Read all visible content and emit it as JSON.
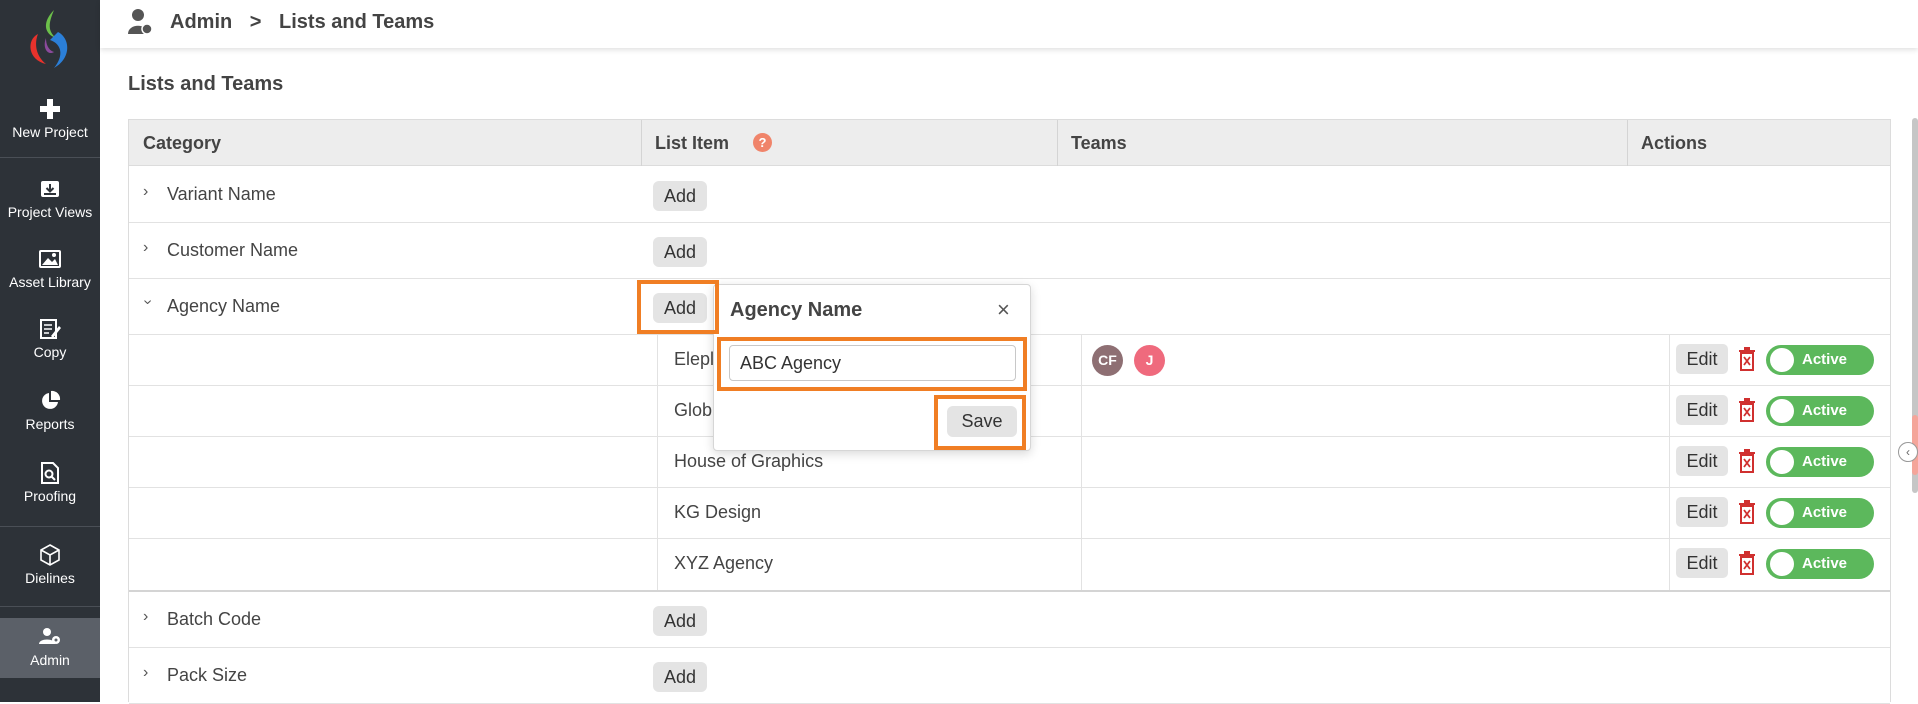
{
  "sidebar": {
    "items": [
      {
        "label": "New Project",
        "icon": "plus-icon"
      },
      {
        "label": "Project Views",
        "icon": "project-views-icon"
      },
      {
        "label": "Asset Library",
        "icon": "image-icon"
      },
      {
        "label": "Copy",
        "icon": "copy-edit-icon"
      },
      {
        "label": "Reports",
        "icon": "pie-chart-icon"
      },
      {
        "label": "Proofing",
        "icon": "proofing-search-icon"
      },
      {
        "label": "Dielines",
        "icon": "cube-icon"
      },
      {
        "label": "Admin",
        "icon": "admin-user-icon"
      }
    ]
  },
  "header": {
    "breadcrumb": {
      "root": "Admin",
      "separator": ">",
      "current": "Lists and Teams"
    }
  },
  "page": {
    "title": "Lists and Teams"
  },
  "table": {
    "columns": {
      "category": "Category",
      "list_item": "List Item",
      "help": "?",
      "teams": "Teams",
      "actions": "Actions"
    },
    "add_label": "Add",
    "edit_label": "Edit",
    "active_label": "Active",
    "categories": [
      {
        "label": "Variant Name",
        "expanded": false
      },
      {
        "label": "Customer Name",
        "expanded": false
      },
      {
        "label": "Agency Name",
        "expanded": true
      },
      {
        "label": "Batch Code",
        "expanded": false
      },
      {
        "label": "Pack Size",
        "expanded": false
      }
    ],
    "agency_items": [
      {
        "label": "Elephant",
        "teams": [
          "CF",
          "J"
        ]
      },
      {
        "label": "Global",
        "teams": []
      },
      {
        "label": "House of Graphics",
        "teams": []
      },
      {
        "label": "KG Design",
        "teams": []
      },
      {
        "label": "XYZ Agency",
        "teams": []
      }
    ],
    "visible_item_labels": [
      "Elepl",
      "Glob",
      "House of Graphics",
      "KG Design",
      "XYZ Agency"
    ],
    "team_avatars": [
      {
        "initials": "CF",
        "color": "#8e6f73"
      },
      {
        "initials": "J",
        "color": "#ef6a7d"
      }
    ]
  },
  "popover": {
    "title": "Agency Name",
    "input_value": "ABC Agency",
    "save_label": "Save",
    "close_icon": "close-icon"
  },
  "colors": {
    "sidebar_bg": "#2d3238",
    "highlight": "#f07e24",
    "toggle_active": "#5cb85c",
    "delete_icon": "#d0302f",
    "help_icon": "#f0846a"
  }
}
